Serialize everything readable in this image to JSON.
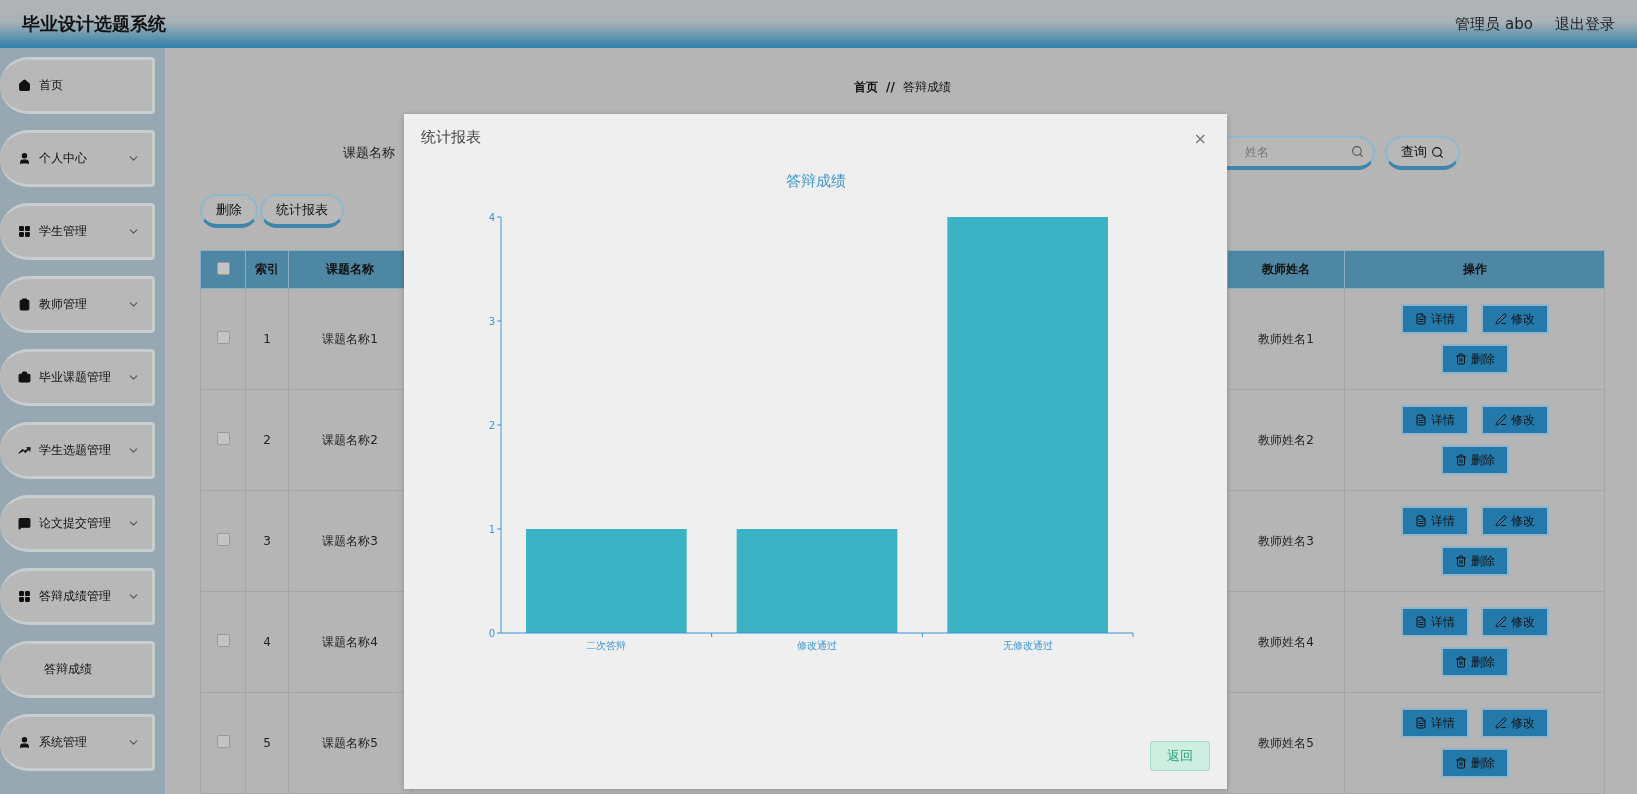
{
  "header": {
    "title": "毕业设计选题系统",
    "user": "管理员 abo",
    "logout": "退出登录"
  },
  "sidebar": {
    "items": [
      {
        "label": "首页",
        "expandable": false
      },
      {
        "label": "个人中心",
        "expandable": true
      },
      {
        "label": "学生管理",
        "expandable": true
      },
      {
        "label": "教师管理",
        "expandable": true
      },
      {
        "label": "毕业课题管理",
        "expandable": true
      },
      {
        "label": "学生选题管理",
        "expandable": true
      },
      {
        "label": "论文提交管理",
        "expandable": true
      },
      {
        "label": "答辩成绩管理",
        "expandable": true,
        "children": [
          {
            "label": "答辩成绩"
          }
        ]
      },
      {
        "label": "系统管理",
        "expandable": true
      }
    ]
  },
  "breadcrumb": [
    "首页",
    "//",
    "答辩成绩"
  ],
  "search": {
    "label": "课题名称",
    "field_placeholder": "姓名",
    "button": "查询"
  },
  "actions": [
    "删除",
    "统计报表"
  ],
  "table": {
    "select_all": false,
    "columns": [
      "索引",
      "课题名称",
      "教师姓名",
      "操作"
    ],
    "rows": [
      {
        "checked": false,
        "cells": [
          "1",
          "课题名称1",
          "教师姓名1"
        ],
        "buttons": [
          "详情",
          "修改",
          "删除"
        ]
      },
      {
        "checked": false,
        "cells": [
          "2",
          "课题名称2",
          "教师姓名2"
        ],
        "buttons": [
          "详情",
          "修改",
          "删除"
        ]
      },
      {
        "checked": false,
        "cells": [
          "3",
          "课题名称3",
          "教师姓名3"
        ],
        "buttons": [
          "详情",
          "修改",
          "删除"
        ]
      },
      {
        "checked": false,
        "cells": [
          "4",
          "课题名称4",
          "教师姓名4"
        ],
        "buttons": [
          "详情",
          "修改",
          "删除"
        ]
      },
      {
        "checked": false,
        "cells": [
          "5",
          "课题名称5",
          "教师姓名5"
        ],
        "buttons": [
          "详情",
          "修改",
          "删除"
        ]
      }
    ]
  },
  "modal": {
    "title": "统计报表",
    "close": "×",
    "back_button": "返回",
    "chart_data": {
      "type": "bar",
      "title": "答辩成绩",
      "categories": [
        "二次答辩",
        "修改通过",
        "无修改通过"
      ],
      "values": [
        1,
        1,
        4
      ],
      "ylim": [
        0,
        4
      ],
      "yticks": [
        0,
        1,
        2,
        3,
        4
      ]
    }
  }
}
